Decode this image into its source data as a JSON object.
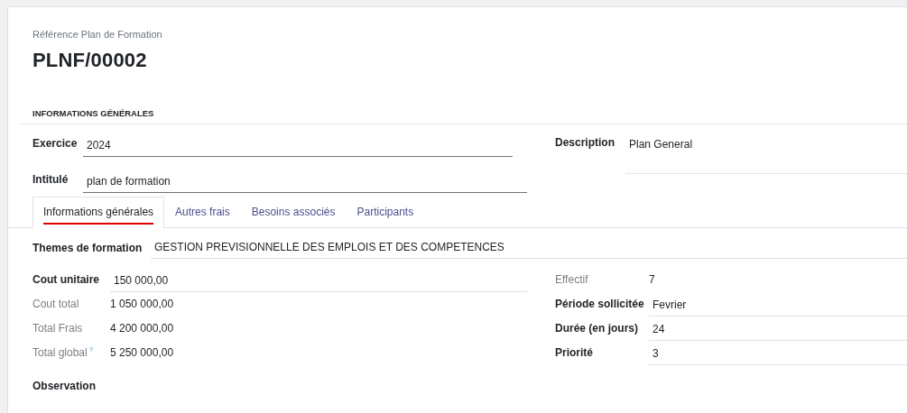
{
  "header": {
    "reference_label": "Référence Plan de Formation",
    "reference": "PLNF/00002"
  },
  "section_title": "INFORMATIONS GÉNÉRALES",
  "top_left_fields": [
    {
      "label": "Exercice",
      "value": "2024",
      "required": true
    },
    {
      "label": "Intitulé",
      "value": "plan de formation",
      "required": true
    }
  ],
  "description": {
    "label": "Description",
    "value": "Plan General"
  },
  "tabs": [
    {
      "label": "Informations générales",
      "selected": true
    },
    {
      "label": "Autres frais",
      "selected": false
    },
    {
      "label": "Besoins associés",
      "selected": false
    },
    {
      "label": "Participants",
      "selected": false
    }
  ],
  "themes": {
    "label": "Themes de formation",
    "value": "GESTION PREVISIONNELLE DES EMPLOIS ET DES COMPETENCES"
  },
  "left_fields": [
    {
      "kind": "input",
      "label": "Cout unitaire",
      "value": "150 000,00"
    },
    {
      "kind": "readonly",
      "label": "Cout total",
      "value": "1 050 000,00"
    },
    {
      "kind": "readonly",
      "label": "Total Frais",
      "value": "4 200 000,00"
    },
    {
      "kind": "readonly",
      "label": "Total global",
      "help": "?",
      "value": "5 250 000,00"
    }
  ],
  "right_fields": [
    {
      "kind": "readonly",
      "label": "Effectif",
      "value": "7"
    },
    {
      "kind": "input",
      "label": "Période sollicitée",
      "value": "Fevrier"
    },
    {
      "kind": "input",
      "label": "Durée (en jours)",
      "value": "24"
    },
    {
      "kind": "input",
      "label": "Priorité",
      "value": "3"
    }
  ],
  "observation": {
    "label": "Observation"
  }
}
